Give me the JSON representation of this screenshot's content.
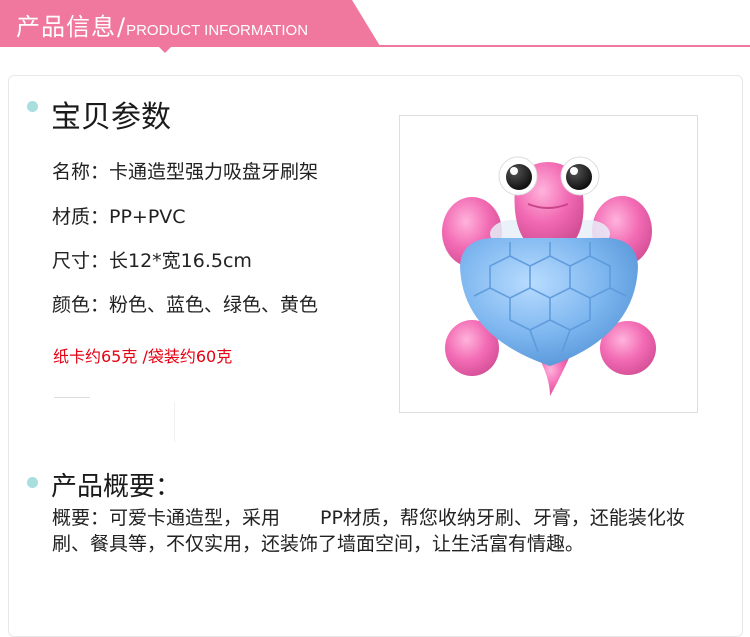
{
  "header": {
    "title_cn": "产品信息",
    "separator": "/",
    "title_en": "PRODUCT INFORMATION"
  },
  "params": {
    "heading": "宝贝参数",
    "name": "名称：卡通造型强力吸盘牙刷架",
    "material": "材质：PP+PVC",
    "size": "尺寸：长12*宽16.5cm",
    "colors": "颜色：粉色、蓝色、绿色、黄色",
    "weight": "纸卡约65克 /袋装约60克"
  },
  "overview": {
    "heading": "产品概要：",
    "text_part1": "概要：可爱卡通造型，采用",
    "text_part2": "PP材质，帮您收纳牙刷、牙膏，还能装化妆刷、餐具等，不仅实用，还装饰了墙面空间，让生活富有情趣。"
  },
  "colors": {
    "accent_pink": "#f0789f",
    "bullet_teal": "#a8dede",
    "highlight_red": "#e60012",
    "turtle_pink": "#f06fb4",
    "turtle_blue": "#79b4ee"
  }
}
